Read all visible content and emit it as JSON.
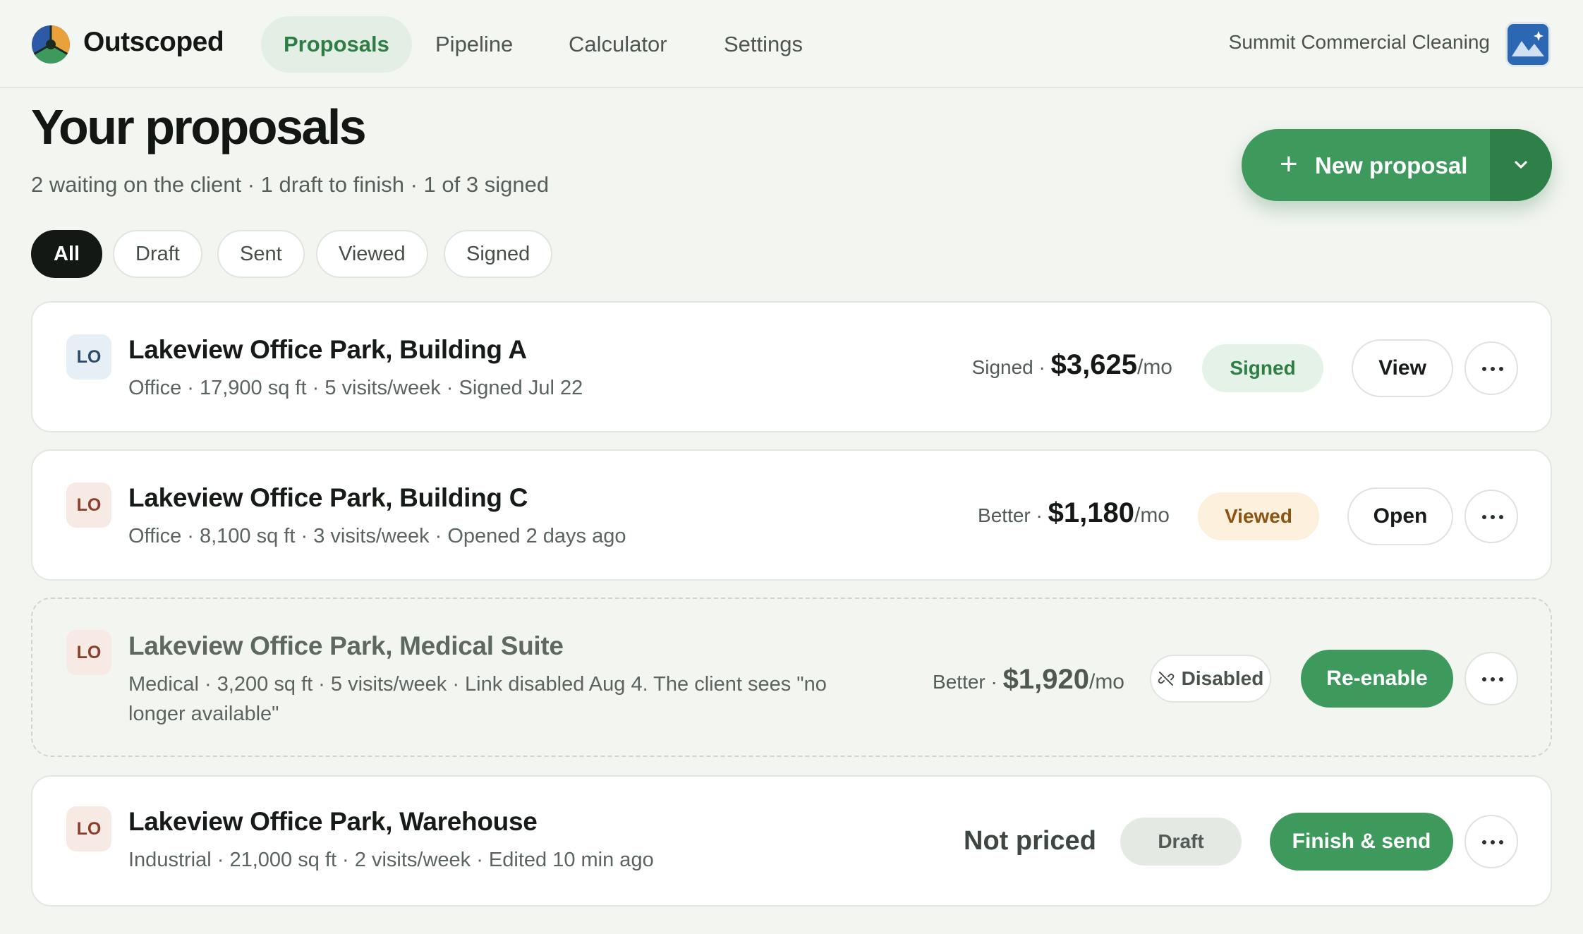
{
  "app": {
    "brand": "Outscoped"
  },
  "nav": {
    "tabs": [
      {
        "label": "Proposals",
        "active": true
      },
      {
        "label": "Pipeline"
      },
      {
        "label": "Calculator"
      },
      {
        "label": "Settings"
      }
    ],
    "company": "Summit Commercial Cleaning"
  },
  "header": {
    "title": "Your proposals",
    "subtitle": "2 waiting on the client · 1 draft to finish · 1 of 3 signed",
    "new_button": "New proposal"
  },
  "filters": [
    {
      "label": "All",
      "active": true
    },
    {
      "label": "Draft"
    },
    {
      "label": "Sent"
    },
    {
      "label": "Viewed"
    },
    {
      "label": "Signed"
    }
  ],
  "proposals": [
    {
      "initials": "LO",
      "title": "Lakeview Office Park, Building A",
      "meta": "Office · 17,900 sq ft · 5 visits/week · Signed Jul 22",
      "tier": "Signed ·",
      "amount": "$3,625",
      "unit": "/mo",
      "status": "Signed",
      "action": "View"
    },
    {
      "initials": "LO",
      "title": "Lakeview Office Park, Building C",
      "meta": "Office · 8,100 sq ft · 3 visits/week · Opened 2 days ago",
      "tier": "Better ·",
      "amount": "$1,180",
      "unit": "/mo",
      "status": "Viewed",
      "action": "Open"
    },
    {
      "initials": "LO",
      "title": "Lakeview Office Park, Medical Suite",
      "meta_line1": "Medical · 3,200 sq ft · 5 visits/week · Link disabled Aug 4. The client sees \"no",
      "meta_line2": "longer available\"",
      "tier": "Better ·",
      "amount": "$1,920",
      "unit": "/mo",
      "status": "Disabled",
      "action": "Re-enable"
    },
    {
      "initials": "LO",
      "title": "Lakeview Office Park, Warehouse",
      "meta": "Industrial · 21,000 sq ft · 2 visits/week · Edited 10 min ago",
      "price_text": "Not priced",
      "status": "Draft",
      "action": "Finish & send"
    }
  ],
  "colors": {
    "accent": "#3d9a5c",
    "accent_dark": "#2f7f48",
    "background": "#f3f5f1",
    "signed_badge": "#e5f2e8",
    "viewed_badge": "#fdf0dc"
  },
  "icons": [
    "logo-icon",
    "avatar-icon",
    "plus-icon",
    "chevron-down-icon",
    "link-off-icon",
    "more-icon"
  ]
}
